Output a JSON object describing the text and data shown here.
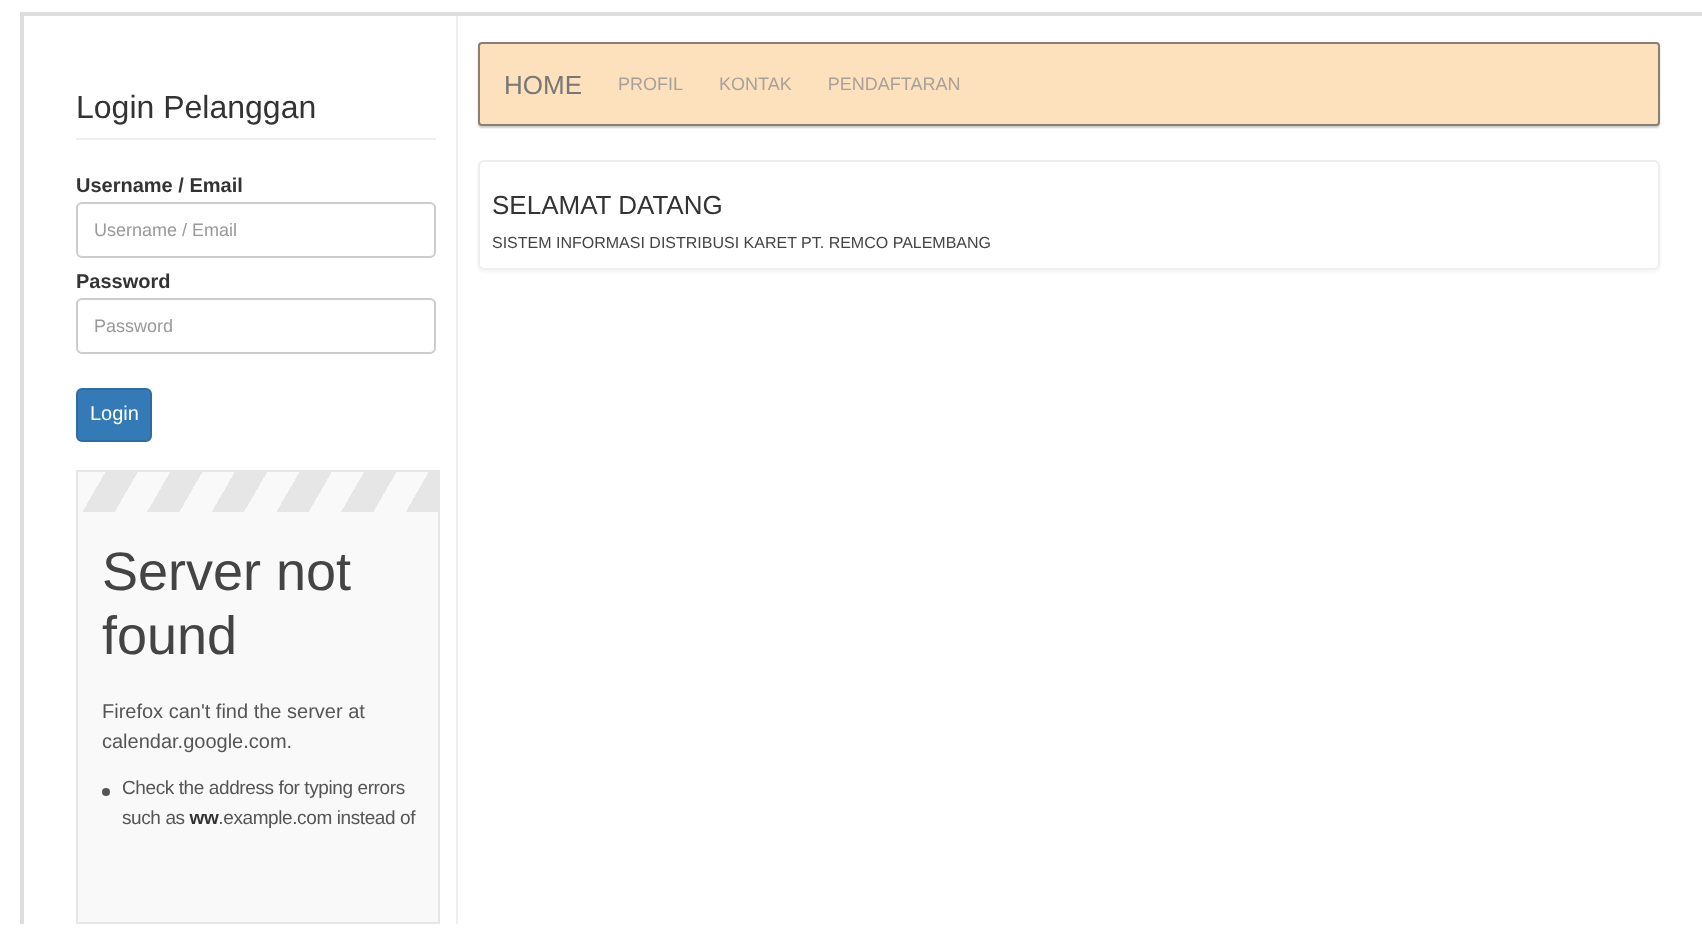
{
  "login": {
    "title": "Login Pelanggan",
    "fields": [
      {
        "label": "Username / Email",
        "placeholder": "Username / Email"
      },
      {
        "label": "Password",
        "placeholder": "Password"
      }
    ],
    "button": "Login"
  },
  "error_frame": {
    "title": "Server not found",
    "message": "Firefox can't find the server at calendar.google.com.",
    "bullets": [
      "Check the address for typing errors such as **ww**.example.com instead of"
    ]
  },
  "nav": [
    {
      "label": "HOME",
      "selected": true
    },
    {
      "label": "PROFIL",
      "selected": false
    },
    {
      "label": "KONTAK",
      "selected": false
    },
    {
      "label": "PENDAFTARAN",
      "selected": false
    }
  ],
  "welcome": {
    "title": "SELAMAT DATANG",
    "subtitle": "SISTEM INFORMASI DISTRIBUSI KARET PT. REMCO PALEMBANG"
  }
}
